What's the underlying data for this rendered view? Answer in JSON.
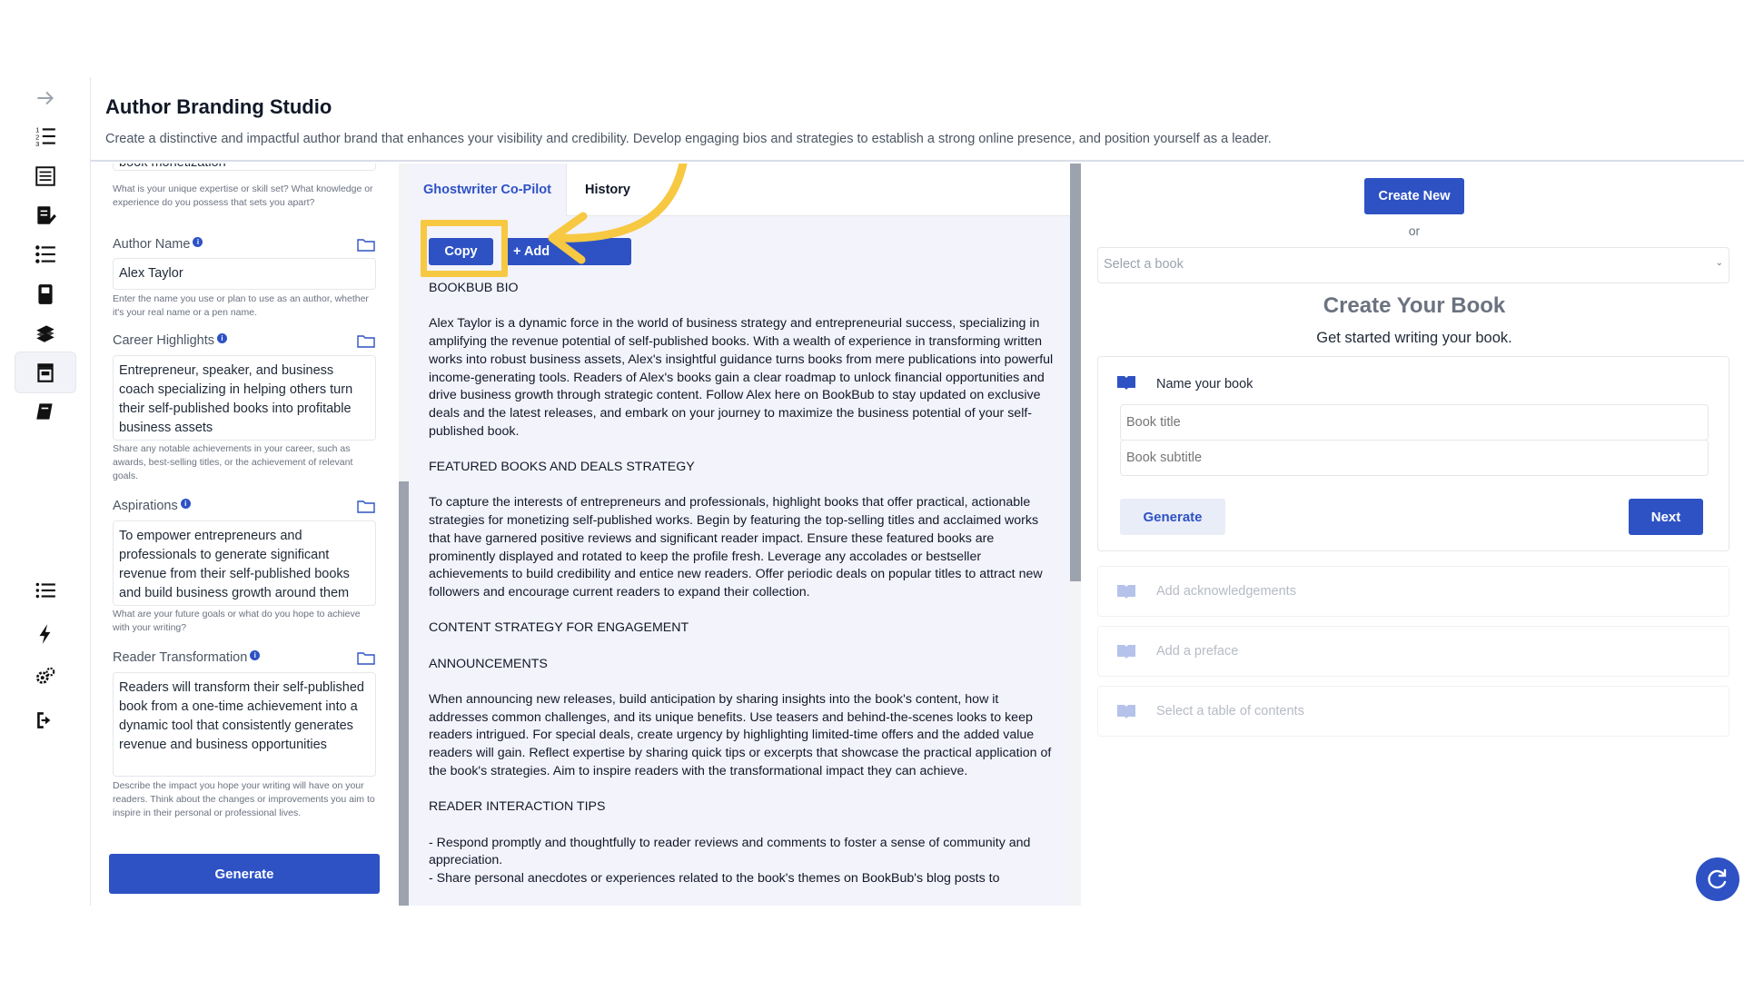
{
  "header": {
    "title": "Author Branding Studio",
    "subtitle": "Create a distinctive and impactful author brand that enhances your visibility and credibility. Develop engaging bios and strategies to establish a strong online presence, and position yourself as a leader."
  },
  "nav": {
    "items": [
      {
        "icon": "arrow-right-icon"
      },
      {
        "icon": "numbered-list-icon"
      },
      {
        "icon": "book-pages-icon"
      },
      {
        "icon": "book-edit-icon"
      },
      {
        "icon": "checklist-icon"
      },
      {
        "icon": "notebook-icon"
      },
      {
        "icon": "books-stack-icon"
      },
      {
        "icon": "storefront-icon",
        "active": true
      },
      {
        "icon": "book-icon"
      },
      {
        "icon": "list-icon"
      },
      {
        "icon": "lightning-icon"
      },
      {
        "icon": "gears-icon"
      },
      {
        "icon": "logout-icon"
      }
    ]
  },
  "form": {
    "top_field_value": "book monetization",
    "expertise_hint": "What is your unique expertise or skill set? What knowledge or experience do you possess that sets you apart?",
    "author_name": {
      "label": "Author Name",
      "value": "Alex Taylor",
      "hint": "Enter the name you use or plan to use as an author, whether it's your real name or a pen name."
    },
    "career_highlights": {
      "label": "Career Highlights",
      "value": "Entrepreneur, speaker, and business coach specializing in helping others turn their self-published books into profitable business assets",
      "hint": "Share any notable achievements in your career, such as awards, best-selling titles, or the achievement of relevant goals."
    },
    "aspirations": {
      "label": "Aspirations",
      "value": "To empower entrepreneurs and professionals to generate significant revenue from their self-published books and build business growth around them",
      "hint": "What are your future goals or what do you hope to achieve with your writing?"
    },
    "reader_transformation": {
      "label": "Reader Transformation",
      "value": "Readers will transform their self-published book from a one-time achievement into a dynamic tool that consistently generates revenue and business opportunities",
      "hint": "Describe the impact you hope your writing will have on your readers. Think about the changes or improvements you aim to inspire in their personal or professional lives."
    },
    "generate_label": "Generate"
  },
  "middle": {
    "tabs": [
      {
        "label": "Ghostwriter Co-Pilot",
        "active": true
      },
      {
        "label": "History"
      }
    ],
    "copy_label": "Copy",
    "add_label": "+ Add",
    "paragraphs": [
      "BOOKBUB BIO",
      "Alex Taylor is a dynamic force in the world of business strategy and entrepreneurial success, specializing in amplifying the revenue potential of self-published books. With a wealth of experience in transforming written works into robust business assets, Alex's insightful guidance turns books from mere publications into powerful income-generating tools. Readers of Alex's books gain a clear roadmap to unlock financial opportunities and drive business growth through strategic content. Follow Alex here on BookBub to stay updated on exclusive deals and the latest releases, and embark on your journey to maximize the business potential of your self-published book.",
      "FEATURED BOOKS AND DEALS STRATEGY",
      "To capture the interests of entrepreneurs and professionals, highlight books that offer practical, actionable strategies for monetizing self-published works. Begin by featuring the top-selling titles and acclaimed works that have garnered positive reviews and significant reader impact. Ensure these featured books are prominently displayed and rotated to keep the profile fresh. Leverage any accolades or bestseller achievements to build credibility and entice new readers. Offer periodic deals on popular titles to attract new followers and encourage current readers to expand their collection.",
      "CONTENT STRATEGY FOR ENGAGEMENT",
      "ANNOUNCEMENTS",
      "When announcing new releases, build anticipation by sharing insights into the book's content, how it addresses common challenges, and its unique benefits. Use teasers and behind-the-scenes looks to keep readers intrigued. For special deals, create urgency by highlighting limited-time offers and the added value readers will gain. Reflect expertise by sharing quick tips or excerpts that showcase the practical application of the book's strategies. Aim to inspire readers with the transformational impact they can achieve.",
      "READER INTERACTION TIPS",
      "- Respond promptly and thoughtfully to reader reviews and comments to foster a sense of community and appreciation.\n- Share personal anecdotes or experiences related to the book's themes on BookBub's blog posts to"
    ]
  },
  "right": {
    "create_new_label": "Create New",
    "or_text": "or",
    "select_placeholder": "Select a book",
    "create_title": "Create Your Book",
    "create_subtitle": "Get started writing your book.",
    "name_label": "Name your book",
    "book_title_placeholder": "Book title",
    "book_subtitle_placeholder": "Book subtitle",
    "generate_label": "Generate",
    "next_label": "Next",
    "steps": [
      "Add acknowledgements",
      "Add a preface",
      "Select a table of contents"
    ]
  },
  "colors": {
    "accent": "#2e52c4",
    "highlight": "#f7c842",
    "panel_bg": "#f3f3fc"
  }
}
